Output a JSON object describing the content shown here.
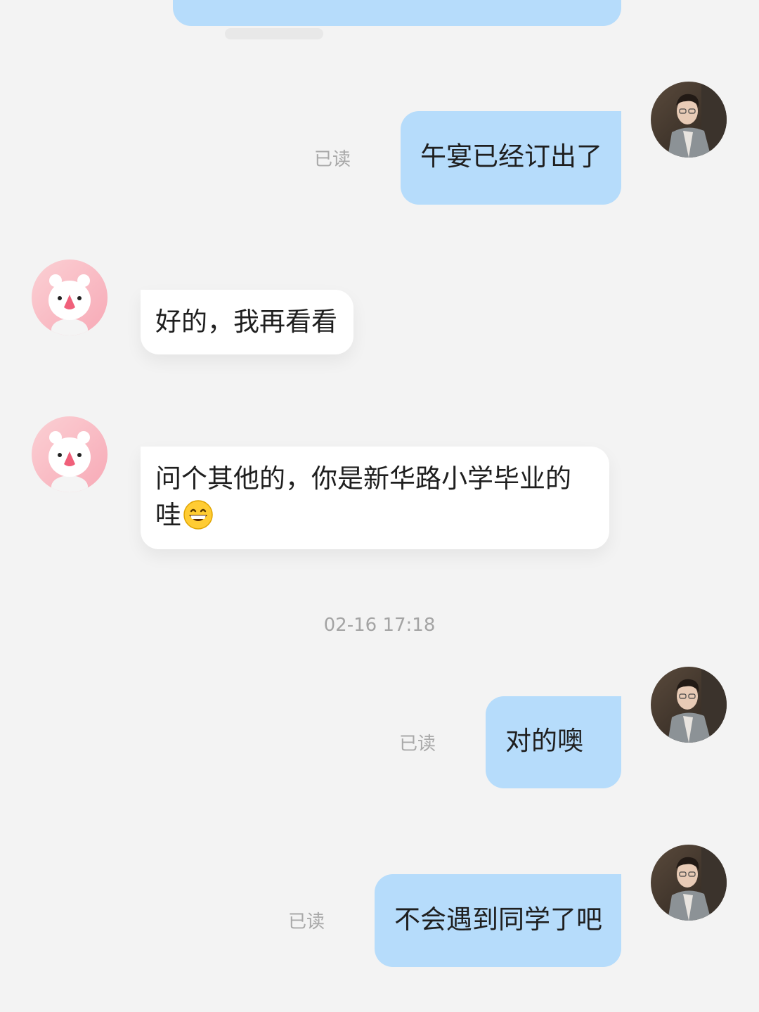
{
  "messages": [
    {
      "id": "m1",
      "direction": "outgoing",
      "text": "午宴已经订出了",
      "status": "已读"
    },
    {
      "id": "m2",
      "direction": "incoming",
      "text": "好的，我再看看"
    },
    {
      "id": "m3",
      "direction": "incoming",
      "text_line1": "问个其他的，你是新华路小学毕业的",
      "text_line2": "哇",
      "emoji": "grinning-face-emoji"
    },
    {
      "id": "m4",
      "direction": "outgoing",
      "text": "对的噢",
      "status": "已读"
    },
    {
      "id": "m5",
      "direction": "outgoing",
      "text": "不会遇到同学了吧",
      "status": "已读"
    }
  ],
  "timestamp": "02-16 17:18",
  "avatars": {
    "self": "man-in-suit-avatar",
    "contact": "cartoon-bear-avatar"
  },
  "colors": {
    "background": "#f3f3f3",
    "outgoing_bubble": "#b6dcfb",
    "incoming_bubble": "#ffffff",
    "muted_text": "#a8a8a8"
  }
}
